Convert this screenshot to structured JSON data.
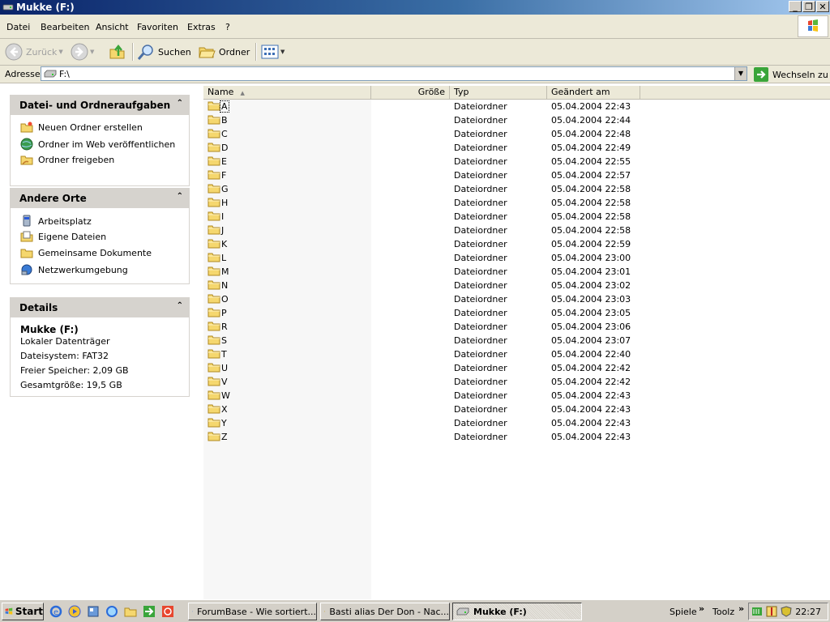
{
  "window": {
    "title": "Mukke (F:)",
    "minimize_label": "_",
    "maximize_label": "❐",
    "close_label": "✕"
  },
  "menu": [
    "Datei",
    "Bearbeiten",
    "Ansicht",
    "Favoriten",
    "Extras",
    "?"
  ],
  "toolbar": {
    "back_label": "Zurück",
    "search_label": "Suchen",
    "folders_label": "Ordner"
  },
  "address": {
    "label": "Adresse",
    "value": "F:\\",
    "go_label": "Wechseln zu"
  },
  "panels": {
    "tasks": {
      "title": "Datei- und Ordneraufgaben",
      "items": [
        {
          "label": "Neuen Ordner erstellen",
          "icon": "new-folder-icon"
        },
        {
          "label": "Ordner im Web veröffentlichen",
          "icon": "web-publish-icon"
        },
        {
          "label": "Ordner freigeben",
          "icon": "share-folder-icon"
        }
      ]
    },
    "places": {
      "title": "Andere Orte",
      "items": [
        {
          "label": "Arbeitsplatz",
          "icon": "computer-icon"
        },
        {
          "label": "Eigene Dateien",
          "icon": "my-documents-icon"
        },
        {
          "label": "Gemeinsame Dokumente",
          "icon": "shared-documents-icon"
        },
        {
          "label": "Netzwerkumgebung",
          "icon": "network-icon"
        }
      ]
    },
    "details": {
      "title": "Details",
      "name": "Mukke (F:)",
      "type": "Lokaler Datenträger",
      "filesystem": "Dateisystem: FAT32",
      "free": "Freier Speicher: 2,09 GB",
      "total": "Gesamtgröße: 19,5 GB"
    }
  },
  "columns": {
    "name": "Name",
    "size": "Größe",
    "type": "Typ",
    "modified": "Geändert am"
  },
  "files": [
    {
      "name": "A",
      "type": "Dateiordner",
      "modified": "05.04.2004 22:43"
    },
    {
      "name": "B",
      "type": "Dateiordner",
      "modified": "05.04.2004 22:44"
    },
    {
      "name": "C",
      "type": "Dateiordner",
      "modified": "05.04.2004 22:48"
    },
    {
      "name": "D",
      "type": "Dateiordner",
      "modified": "05.04.2004 22:49"
    },
    {
      "name": "E",
      "type": "Dateiordner",
      "modified": "05.04.2004 22:55"
    },
    {
      "name": "F",
      "type": "Dateiordner",
      "modified": "05.04.2004 22:57"
    },
    {
      "name": "G",
      "type": "Dateiordner",
      "modified": "05.04.2004 22:58"
    },
    {
      "name": "H",
      "type": "Dateiordner",
      "modified": "05.04.2004 22:58"
    },
    {
      "name": "I",
      "type": "Dateiordner",
      "modified": "05.04.2004 22:58"
    },
    {
      "name": "J",
      "type": "Dateiordner",
      "modified": "05.04.2004 22:58"
    },
    {
      "name": "K",
      "type": "Dateiordner",
      "modified": "05.04.2004 22:59"
    },
    {
      "name": "L",
      "type": "Dateiordner",
      "modified": "05.04.2004 23:00"
    },
    {
      "name": "M",
      "type": "Dateiordner",
      "modified": "05.04.2004 23:01"
    },
    {
      "name": "N",
      "type": "Dateiordner",
      "modified": "05.04.2004 23:02"
    },
    {
      "name": "O",
      "type": "Dateiordner",
      "modified": "05.04.2004 23:03"
    },
    {
      "name": "P",
      "type": "Dateiordner",
      "modified": "05.04.2004 23:05"
    },
    {
      "name": "R",
      "type": "Dateiordner",
      "modified": "05.04.2004 23:06"
    },
    {
      "name": "S",
      "type": "Dateiordner",
      "modified": "05.04.2004 23:07"
    },
    {
      "name": "T",
      "type": "Dateiordner",
      "modified": "05.04.2004 22:40"
    },
    {
      "name": "U",
      "type": "Dateiordner",
      "modified": "05.04.2004 22:42"
    },
    {
      "name": "V",
      "type": "Dateiordner",
      "modified": "05.04.2004 22:42"
    },
    {
      "name": "W",
      "type": "Dateiordner",
      "modified": "05.04.2004 22:43"
    },
    {
      "name": "X",
      "type": "Dateiordner",
      "modified": "05.04.2004 22:43"
    },
    {
      "name": "Y",
      "type": "Dateiordner",
      "modified": "05.04.2004 22:43"
    },
    {
      "name": "Z",
      "type": "Dateiordner",
      "modified": "05.04.2004 22:43"
    }
  ],
  "taskbar": {
    "start_label": "Start",
    "tasks": [
      {
        "label": "ForumBase - Wie sortiert...",
        "icon": "browser-icon",
        "active": false
      },
      {
        "label": "Basti alias Der Don - Nac...",
        "icon": "message-icon",
        "active": false
      },
      {
        "label": "Mukke (F:)",
        "icon": "drive-icon",
        "active": true
      }
    ],
    "toolbar1_label": "Spiele",
    "toolbar2_label": "Toolz",
    "chevron": "»",
    "clock": "22:27"
  },
  "colors": {
    "title_bar_start": "#0a246a",
    "title_bar_end": "#a6caf0",
    "folder_yellow": "#f5d76e",
    "panel_header": "#d6d3ce",
    "accent_green": "#3aa53a"
  }
}
